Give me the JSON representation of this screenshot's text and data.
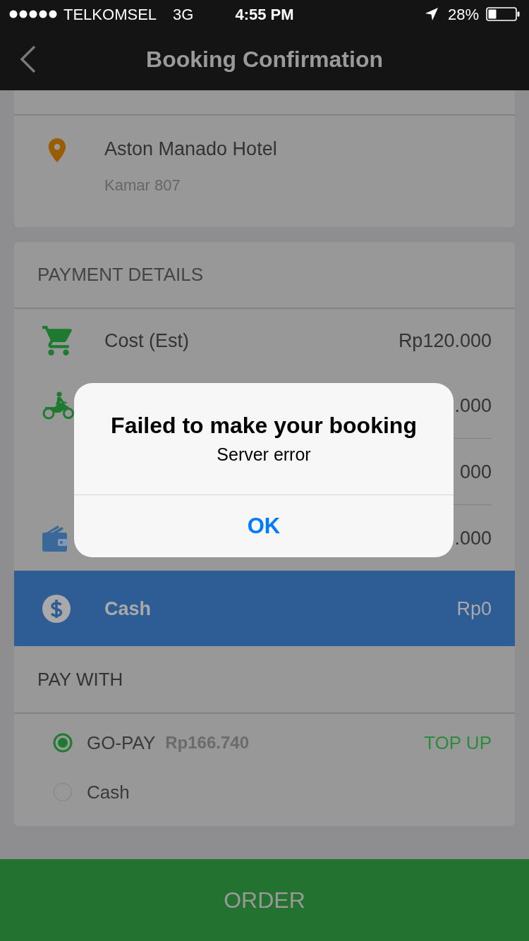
{
  "status_bar": {
    "carrier": "TELKOMSEL",
    "network": "3G",
    "time": "4:55 PM",
    "battery": "28%"
  },
  "nav_bar": {
    "title": "Booking Confirmation"
  },
  "deliver_to": {
    "place": "Aston Manado Hotel",
    "note": "Kamar 807"
  },
  "payment_details": {
    "title": "PAYMENT DETAILS",
    "rows": [
      {
        "kind": "cart",
        "label": "Cost (Est)",
        "value": "Rp120.000"
      },
      {
        "kind": "motorbike",
        "value": ".000"
      },
      {
        "kind": "plain",
        "value": "000"
      },
      {
        "kind": "wallet",
        "value": ".000"
      },
      {
        "kind": "cash",
        "label": "Cash",
        "value": "Rp0"
      }
    ]
  },
  "pay_with": {
    "title": "PAY WITH",
    "options": [
      {
        "label": "GO-PAY",
        "balance": "Rp166.740",
        "action": "TOP UP",
        "selected": true
      },
      {
        "label": "Cash",
        "selected": false
      }
    ]
  },
  "order_button": {
    "label": "ORDER"
  },
  "alert": {
    "title": "Failed to make your booking",
    "message": "Server error",
    "button": "OK"
  }
}
